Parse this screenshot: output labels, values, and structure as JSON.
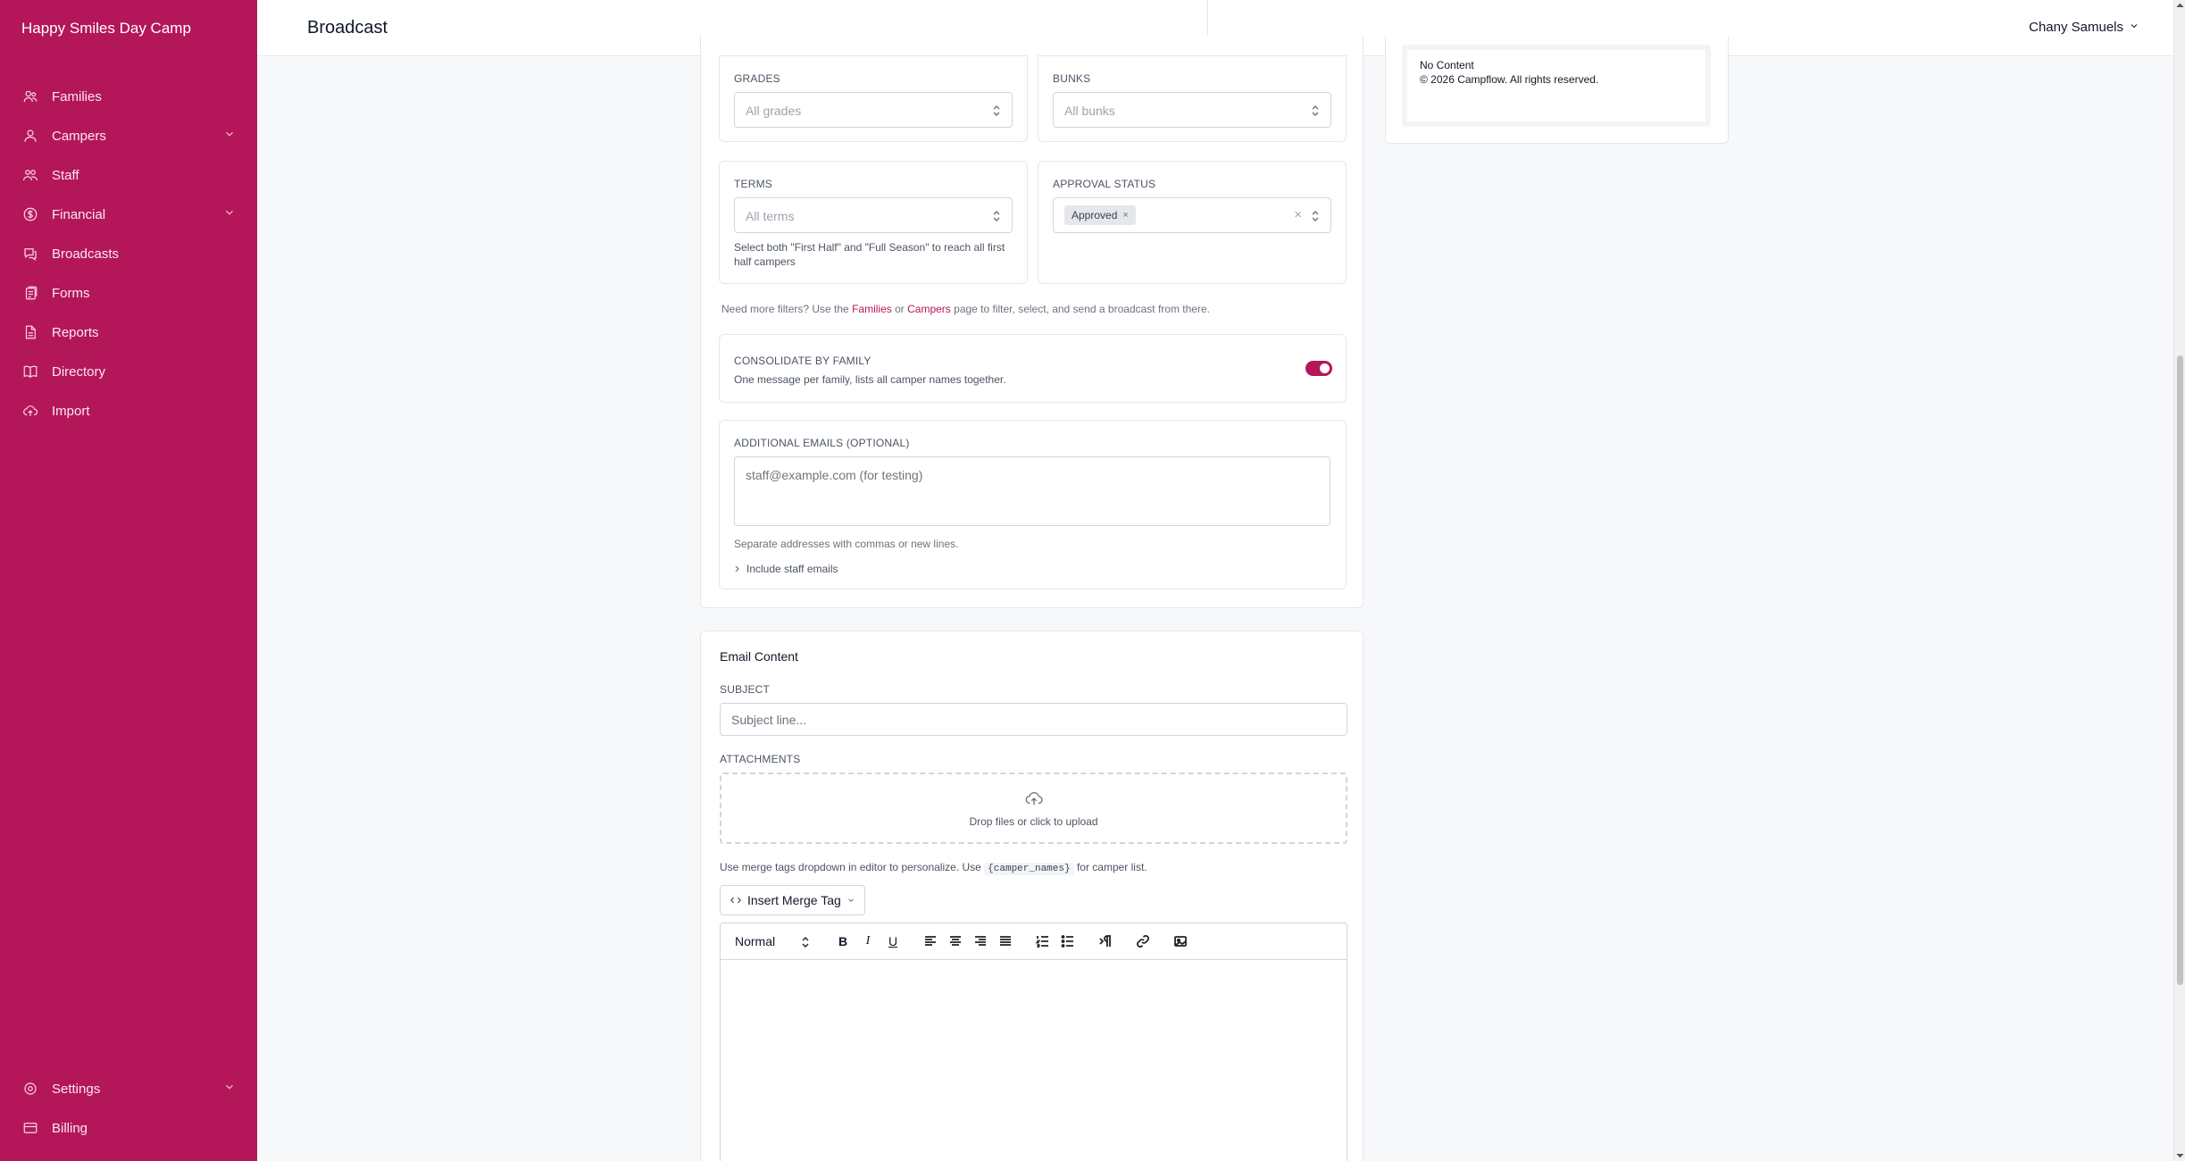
{
  "app": {
    "name": "Happy Smiles Day Camp"
  },
  "sidebar": {
    "items": [
      {
        "label": "Families",
        "icon": "families-icon"
      },
      {
        "label": "Campers",
        "icon": "user-icon",
        "expandable": true
      },
      {
        "label": "Staff",
        "icon": "staff-icon"
      },
      {
        "label": "Financial",
        "icon": "dollar-icon",
        "expandable": true
      },
      {
        "label": "Broadcasts",
        "icon": "broadcast-icon"
      },
      {
        "label": "Forms",
        "icon": "forms-icon"
      },
      {
        "label": "Reports",
        "icon": "reports-icon"
      },
      {
        "label": "Directory",
        "icon": "book-icon"
      },
      {
        "label": "Import",
        "icon": "upload-cloud-icon"
      }
    ],
    "bottom": [
      {
        "label": "Settings",
        "icon": "gear-icon",
        "expandable": true
      },
      {
        "label": "Billing",
        "icon": "card-icon"
      }
    ]
  },
  "header": {
    "title": "Broadcast",
    "user": "Chany Samuels"
  },
  "filters": {
    "grades": {
      "label": "GRADES",
      "placeholder": "All grades"
    },
    "bunks": {
      "label": "BUNKS",
      "placeholder": "All bunks"
    },
    "terms": {
      "label": "TERMS",
      "placeholder": "All terms",
      "hint": "Select both \"First Half\" and \"Full Season\" to reach all first half campers"
    },
    "approval": {
      "label": "APPROVAL STATUS",
      "tag": "Approved",
      "tag_remove": "×",
      "clear": "×"
    },
    "more": {
      "prefix": "Need more filters? Use the",
      "families": "Families",
      "or": "or",
      "campers": "Campers",
      "suffix": "page to filter, select, and send a broadcast from there."
    }
  },
  "consolidate": {
    "label": "CONSOLIDATE BY FAMILY",
    "description": "One message per family, lists all camper names together.",
    "enabled": true
  },
  "additional_emails": {
    "label": "ADDITIONAL EMAILS (OPTIONAL)",
    "placeholder": "staff@example.com (for testing)",
    "hint": "Separate addresses with commas or new lines.",
    "include_staff": "Include staff emails"
  },
  "preview": {
    "no_content": "No Content",
    "footer": "© 2026 Campflow. All rights reserved."
  },
  "email_content": {
    "title": "Email Content",
    "subject_label": "SUBJECT",
    "subject_placeholder": "Subject line...",
    "attachments_label": "ATTACHMENTS",
    "dropzone_text": "Drop files or click to upload",
    "merge_hint_prefix": "Use merge tags dropdown in editor to personalize. Use",
    "merge_hint_code": "{camper_names}",
    "merge_hint_suffix": "for camper list.",
    "merge_button": "Insert Merge Tag",
    "format_select": "Normal"
  }
}
